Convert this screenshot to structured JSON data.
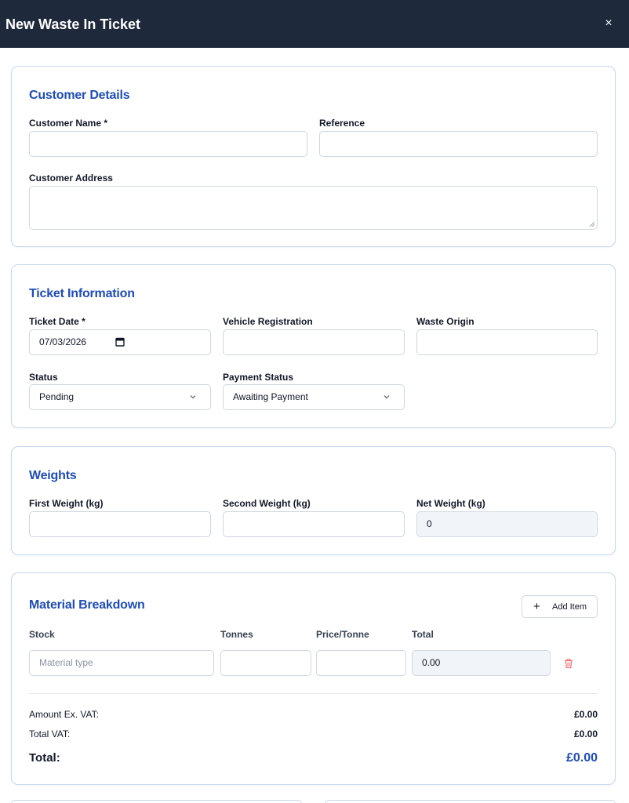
{
  "header": {
    "title": "New Waste In Ticket",
    "close_glyph": "×"
  },
  "customer_details": {
    "title": "Customer Details",
    "customer_name_label": "Customer Name *",
    "customer_name_value": "",
    "reference_label": "Reference",
    "reference_value": "",
    "customer_address_label": "Customer Address",
    "customer_address_value": ""
  },
  "ticket_information": {
    "title": "Ticket Information",
    "ticket_date_label": "Ticket Date *",
    "ticket_date_value": "07/03/2026",
    "vehicle_registration_label": "Vehicle Registration",
    "vehicle_registration_value": "",
    "waste_origin_label": "Waste Origin",
    "waste_origin_value": "",
    "status_label": "Status",
    "status_value": "Pending",
    "payment_status_label": "Payment Status",
    "payment_status_value": "Awaiting Payment"
  },
  "weights": {
    "title": "Weights",
    "first_weight_label": "First Weight (kg)",
    "first_weight_value": "",
    "second_weight_label": "Second Weight (kg)",
    "second_weight_value": "",
    "net_weight_label": "Net Weight (kg)",
    "net_weight_value": "0"
  },
  "material_breakdown": {
    "title": "Material Breakdown",
    "add_item_label": "Add Item",
    "columns": {
      "stock": "Stock",
      "tonnes": "Tonnes",
      "price_per_tonne": "Price/Tonne",
      "total": "Total"
    },
    "rows": [
      {
        "stock_placeholder": "Material type",
        "tonnes": "",
        "price_per_tonne": "",
        "total": "0.00"
      }
    ],
    "summary": {
      "amount_ex_vat_label": "Amount Ex. VAT:",
      "amount_ex_vat_value": "£0.00",
      "total_vat_label": "Total VAT:",
      "total_vat_value": "£0.00",
      "total_label": "Total:",
      "total_value": "£0.00"
    }
  },
  "colors": {
    "header_bg": "#1e293b",
    "section_title": "#1e4cb8",
    "card_border": "#c7d7ee",
    "readonly_bg": "#f1f4f8",
    "delete_icon": "#f87171"
  },
  "icons": [
    "close-icon",
    "calendar-icon",
    "chevron-down-icon",
    "plus-icon",
    "trash-icon",
    "resize-grip-icon"
  ]
}
